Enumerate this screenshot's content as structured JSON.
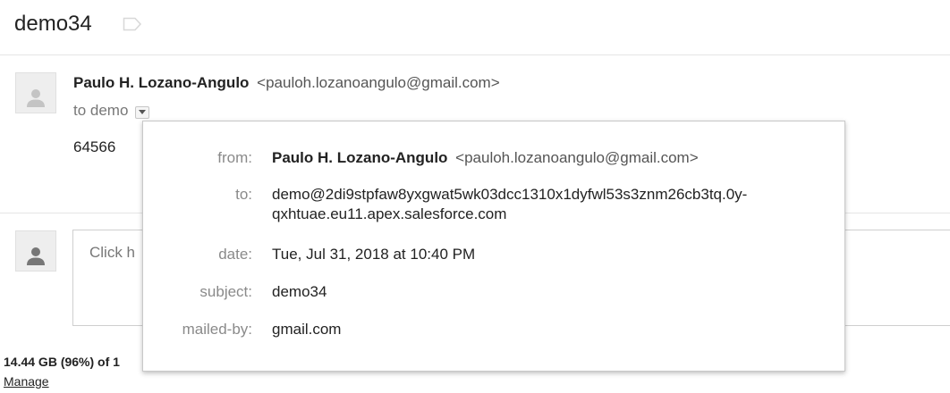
{
  "thread": {
    "subject": "demo34"
  },
  "message": {
    "sender_name": "Paulo H. Lozano-Angulo",
    "sender_email": "<pauloh.lozanoangulo@gmail.com>",
    "to_summary": "to demo",
    "body": "64566"
  },
  "details_popup": {
    "from_label": "from:",
    "from_name": "Paulo H. Lozano-Angulo",
    "from_email": "<pauloh.lozanoangulo@gmail.com>",
    "to_label": "to:",
    "to_value": "demo@2di9stpfaw8yxgwat5wk03dcc1310x1dyfwl53s3znm26cb3tq.0y-qxhtuae.eu11.apex.salesforce.com",
    "date_label": "date:",
    "date_value": "Tue, Jul 31, 2018 at 10:40 PM",
    "subject_label": "subject:",
    "subject_value": "demo34",
    "mailedby_label": "mailed-by:",
    "mailedby_value": "gmail.com"
  },
  "reply": {
    "placeholder": "Click h"
  },
  "storage": {
    "usage_text": "14.44 GB (96%) of 1",
    "manage_label": "Manage"
  },
  "icons": {
    "label_tag": "label-tag-icon",
    "avatar": "person-avatar-icon",
    "details_toggle": "chevron-down-icon"
  }
}
